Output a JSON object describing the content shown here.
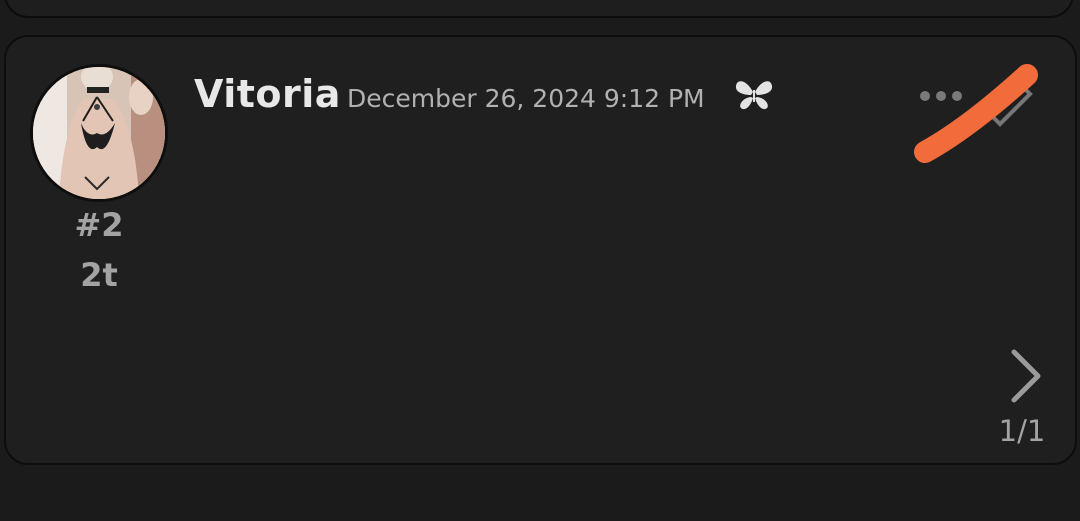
{
  "post": {
    "username": "Vitoria",
    "timestamp": "December 26, 2024 9:12 PM",
    "number": "#2",
    "tag": "2t",
    "badge_icon": "butterfly-icon",
    "menu_icon": "more-dots-icon",
    "edit_icon": "pencil-icon"
  },
  "pagination": {
    "label": "1/1",
    "next_icon": "chevron-right-icon"
  },
  "colors": {
    "background": "#1b1b1b",
    "card": "#1f1f1f",
    "username": "#e8e8e8",
    "muted": "#a3a3a3",
    "redaction": "#f26b3a"
  }
}
